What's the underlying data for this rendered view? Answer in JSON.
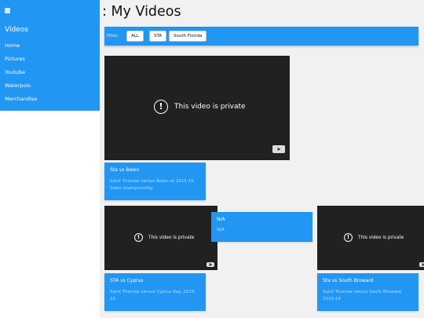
{
  "sidebar": {
    "heading": "Videos",
    "items": [
      {
        "label": "Home"
      },
      {
        "label": "Pictures"
      },
      {
        "label": "Youtube"
      },
      {
        "label": "Waterpolo"
      },
      {
        "label": "Merchandise"
      }
    ]
  },
  "page": {
    "title": ": My Videos"
  },
  "filter": {
    "label": "Filter:",
    "options": [
      "ALL",
      "STA",
      "South Florida"
    ]
  },
  "videos": {
    "private_message": "This video is private",
    "items": [
      {
        "title": "Sta vs Belen",
        "description": "Saint Thomas versus Belen at 2015-16 State championship"
      },
      {
        "title": "N/A",
        "description": "N/A"
      },
      {
        "title": "STA vs Cyprus",
        "description": "Saint Thomas versus Cyprus Bay. 2015-16"
      },
      {
        "title": "Sta vs South Broward",
        "description": "Saint Thomas versus South Broward. 2015-16"
      }
    ]
  },
  "colors": {
    "accent": "#2196f3",
    "player_bg": "#212121",
    "content_bg": "#f1f1f1"
  }
}
